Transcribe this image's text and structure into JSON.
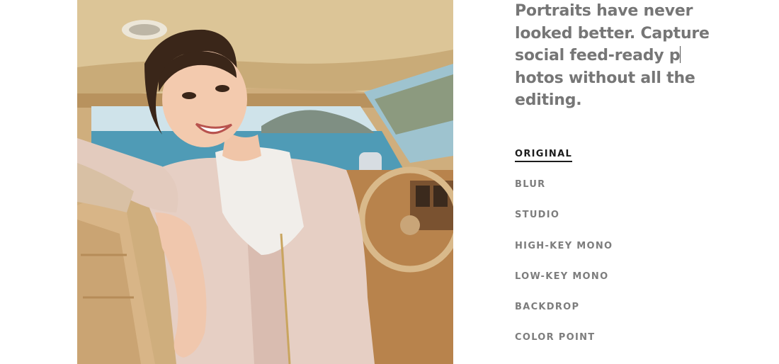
{
  "hero_image": {
    "subject": "portrait-photo"
  },
  "headline": {
    "part1": "Portraits have never looked better. Capture social feed-ready p",
    "part2": "hotos without all the editing."
  },
  "modes": [
    {
      "label": "ORIGINAL",
      "active": true
    },
    {
      "label": "BLUR",
      "active": false
    },
    {
      "label": "STUDIO",
      "active": false
    },
    {
      "label": "HIGH-KEY MONO",
      "active": false
    },
    {
      "label": "LOW-KEY MONO",
      "active": false
    },
    {
      "label": "BACKDROP",
      "active": false
    },
    {
      "label": "COLOR POINT",
      "active": false
    }
  ],
  "colors": {
    "headline": "#767676",
    "mode_inactive": "#7d7d7d",
    "mode_active": "#1c1c1c"
  }
}
